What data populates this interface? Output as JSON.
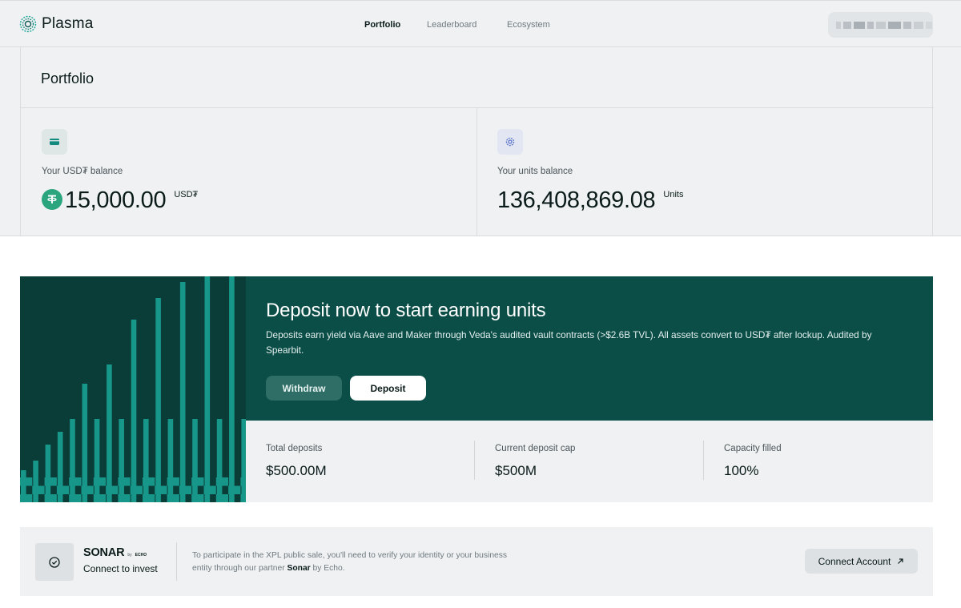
{
  "header": {
    "brand": "Plasma",
    "nav": [
      {
        "label": "Portfolio",
        "active": true
      },
      {
        "label": "Leaderboard",
        "active": false
      },
      {
        "label": "Ecosystem",
        "active": false
      }
    ]
  },
  "portfolio": {
    "title": "Portfolio",
    "usdt_card": {
      "label": "Your USD₮ balance",
      "value": "15,000.00",
      "unit": "USD₮",
      "icon": "wallet-icon"
    },
    "units_card": {
      "label": "Your units balance",
      "value": "136,408,869.08",
      "unit": "Units",
      "icon": "gear-icon"
    }
  },
  "banner": {
    "title": "Deposit now to start earning units",
    "description": "Deposits earn yield via Aave and Maker through Veda's audited vault contracts (>$2.6B TVL). All assets convert to USD₮ after lockup. Audited by Spearbit.",
    "withdraw_label": "Withdraw",
    "deposit_label": "Deposit",
    "stats": [
      {
        "label": "Total deposits",
        "value": "$500.00M"
      },
      {
        "label": "Current deposit cap",
        "value": "$500M"
      },
      {
        "label": "Capacity filled",
        "value": "100%"
      }
    ]
  },
  "sonar": {
    "name": "SONAR",
    "by": "by",
    "echo": "ECHO",
    "cta": "Connect to invest",
    "text_before": "To participate in the XPL public sale, you'll need to verify your identity or your business entity through our partner ",
    "text_partner": "Sonar",
    "text_after": " by Echo.",
    "button_label": "Connect Account",
    "button_icon": "arrow-up-right-icon"
  },
  "colors": {
    "banner_dark": "#0b4d47",
    "art_bg": "#0b3d38",
    "art_bar": "#17968a",
    "panel_bg": "#eff1f3",
    "tether_green": "#2aa57e"
  }
}
